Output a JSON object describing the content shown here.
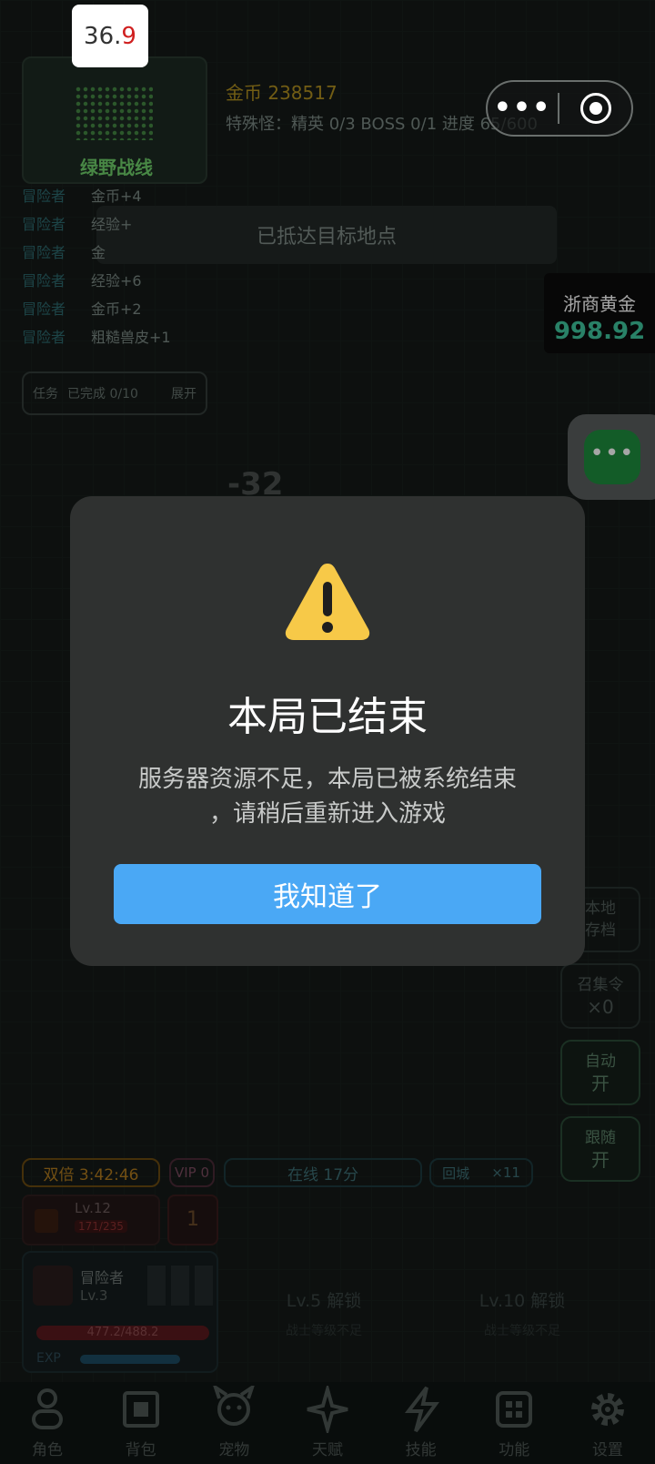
{
  "status_badge": {
    "int": "36.",
    "dec": "9"
  },
  "map": {
    "name": "绿野战线"
  },
  "header": {
    "gold": "金币 238517",
    "special": "特殊怪：精英 0/3    BOSS 0/1    进度 65/600"
  },
  "destination_banner": "已抵达目标地点",
  "loot_log": [
    {
      "who": "冒险者",
      "what": "金币+4"
    },
    {
      "who": "冒险者",
      "what": "经验+"
    },
    {
      "who": "冒险者",
      "what": "金"
    },
    {
      "who": "冒险者",
      "what": "经验+6"
    },
    {
      "who": "冒险者",
      "what": "金币+2"
    },
    {
      "who": "冒险者",
      "what": "粗糙兽皮+1"
    }
  ],
  "task": {
    "label": "任务",
    "progress": "已完成 0/10",
    "expand": "展开"
  },
  "gold_widget": {
    "title": "浙商黄金",
    "value": "998.92"
  },
  "damage_float": "-32",
  "side_buttons": [
    {
      "line1": "本地",
      "line2": "存档"
    },
    {
      "line1": "召集令",
      "line2": "×0"
    },
    {
      "line1": "自动",
      "line2": "开"
    },
    {
      "line1": "跟随",
      "line2": "开"
    }
  ],
  "status_bar": {
    "double": "双倍 3:42:46",
    "vip": "VIP 0",
    "online": "在线 17分",
    "town": "回城",
    "town_count": "×11"
  },
  "level_card": {
    "level": "Lv.12",
    "xp": "171/235",
    "count": "1"
  },
  "hero": {
    "name": "冒险者",
    "level": "Lv.3",
    "hp": "477.2/488.2",
    "exp_label": "EXP"
  },
  "locked_slots": [
    {
      "title": "Lv.5 解锁",
      "note": "战士等级不足"
    },
    {
      "title": "Lv.10 解锁",
      "note": "战士等级不足"
    }
  ],
  "tabs": [
    {
      "label": "角色",
      "icon": "person-icon"
    },
    {
      "label": "背包",
      "icon": "backpack-icon"
    },
    {
      "label": "宠物",
      "icon": "pet-icon"
    },
    {
      "label": "天赋",
      "icon": "star-icon"
    },
    {
      "label": "技能",
      "icon": "lightning-icon"
    },
    {
      "label": "功能",
      "icon": "grid-icon"
    },
    {
      "label": "设置",
      "icon": "gear-icon"
    }
  ],
  "modal": {
    "title": "本局已结束",
    "message_line1": "服务器资源不足，本局已被系统结束",
    "message_line2": "，请稍后重新进入游戏",
    "confirm_label": "我知道了",
    "accent": "#4aa8f5",
    "warning_color": "#f7c948"
  }
}
